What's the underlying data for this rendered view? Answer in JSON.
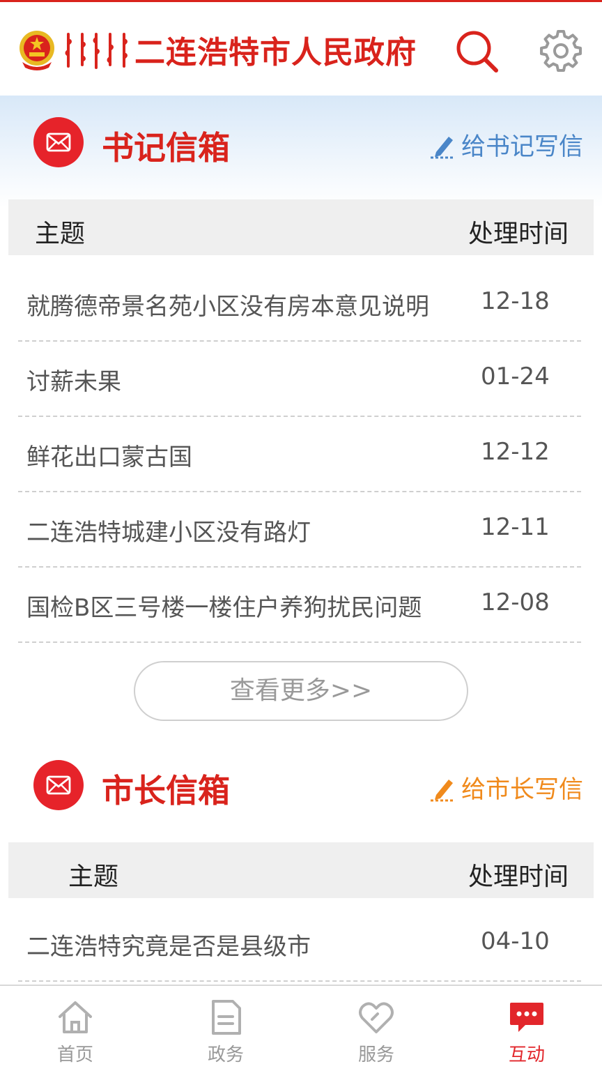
{
  "header": {
    "title": "二连浩特市人民政府",
    "logo_icon": "national-emblem",
    "search_icon": "search-icon",
    "settings_icon": "gear-icon"
  },
  "secretary": {
    "title": "书记信箱",
    "write_label": "给书记写信",
    "col_subject": "主题",
    "col_time": "处理时间",
    "rows": [
      {
        "subject": "就腾德帝景名苑小区没有房本意见说明",
        "date": "12-18"
      },
      {
        "subject": "讨薪未果",
        "date": "01-24"
      },
      {
        "subject": "鲜花出口蒙古国",
        "date": "12-12"
      },
      {
        "subject": "二连浩特城建小区没有路灯",
        "date": "12-11"
      },
      {
        "subject": "国检B区三号楼一楼住户养狗扰民问题",
        "date": "12-08"
      }
    ],
    "more_label": "查看更多>>"
  },
  "mayor": {
    "title": "市长信箱",
    "write_label": "给市长写信",
    "col_subject": "主题",
    "col_time": "处理时间",
    "rows": [
      {
        "subject": "二连浩特究竟是否是县级市",
        "date": "04-10"
      }
    ]
  },
  "tabbar": {
    "items": [
      {
        "label": "首页",
        "icon": "home-icon"
      },
      {
        "label": "政务",
        "icon": "document-icon"
      },
      {
        "label": "服务",
        "icon": "heart-icon"
      },
      {
        "label": "互动",
        "icon": "chat-icon",
        "active": true
      }
    ]
  },
  "colors": {
    "brand_red": "#d9231c",
    "link_blue": "#4a86c8",
    "link_orange": "#f08a1c"
  }
}
